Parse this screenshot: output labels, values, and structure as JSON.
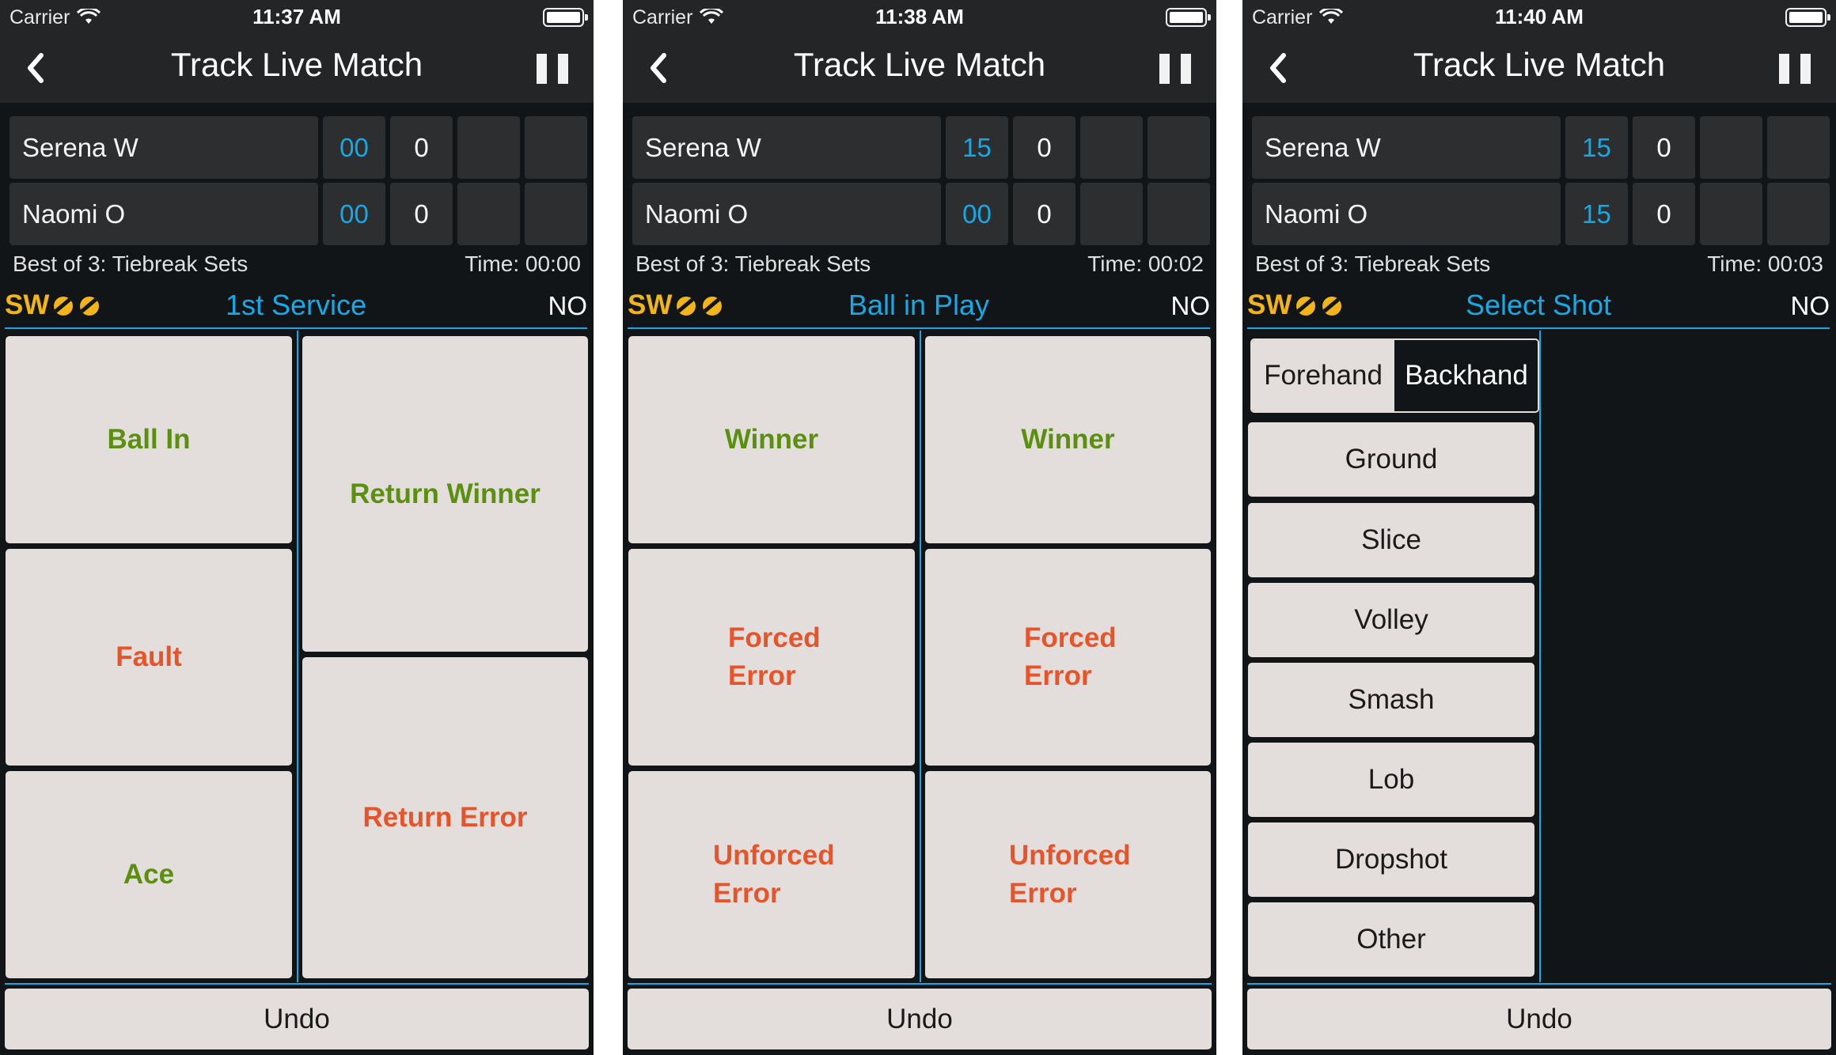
{
  "screens": [
    {
      "status": {
        "carrier": "Carrier",
        "time": "11:37 AM"
      },
      "nav": {
        "title": "Track Live Match"
      },
      "players": [
        {
          "name": "Serena W",
          "points": "00",
          "games": "0"
        },
        {
          "name": "Naomi O",
          "points": "00",
          "games": "0"
        }
      ],
      "info": {
        "format": "Best of 3: Tiebreak Sets",
        "time": "Time: 00:00"
      },
      "state": {
        "server": "SW",
        "label": "1st Service",
        "flag": "NO"
      },
      "buttons": {
        "ball_in": "Ball In",
        "fault": "Fault",
        "ace": "Ace",
        "return_winner": "Return Winner",
        "return_error": "Return Error"
      },
      "undo": "Undo"
    },
    {
      "status": {
        "carrier": "Carrier",
        "time": "11:38 AM"
      },
      "nav": {
        "title": "Track Live Match"
      },
      "players": [
        {
          "name": "Serena W",
          "points": "15",
          "games": "0"
        },
        {
          "name": "Naomi O",
          "points": "00",
          "games": "0"
        }
      ],
      "info": {
        "format": "Best of 3: Tiebreak Sets",
        "time": "Time: 00:02"
      },
      "state": {
        "server": "SW",
        "label": "Ball in Play",
        "flag": "NO"
      },
      "buttons": {
        "left": {
          "winner": "Winner",
          "forced1": "Forced",
          "forced2": "Error",
          "unforced1": "Unforced",
          "unforced2": "Error"
        },
        "right": {
          "winner": "Winner",
          "forced1": "Forced",
          "forced2": "Error",
          "unforced1": "Unforced",
          "unforced2": "Error"
        }
      },
      "undo": "Undo"
    },
    {
      "status": {
        "carrier": "Carrier",
        "time": "11:40 AM"
      },
      "nav": {
        "title": "Track Live Match"
      },
      "players": [
        {
          "name": "Serena W",
          "points": "15",
          "games": "0"
        },
        {
          "name": "Naomi O",
          "points": "15",
          "games": "0"
        }
      ],
      "info": {
        "format": "Best of 3: Tiebreak Sets",
        "time": "Time: 00:03"
      },
      "state": {
        "server": "SW",
        "label": "Select Shot",
        "flag": "NO"
      },
      "segment": {
        "forehand": "Forehand",
        "backhand": "Backhand",
        "selected": "Backhand"
      },
      "shots": [
        "Ground",
        "Slice",
        "Volley",
        "Smash",
        "Lob",
        "Dropshot",
        "Other"
      ],
      "undo": "Undo"
    }
  ],
  "colors": {
    "accent": "#15a9e6",
    "server": "#f2b517",
    "positive": "#5a8f0f",
    "negative": "#e8542a",
    "button": "#e3dedb",
    "background": "#121517"
  }
}
